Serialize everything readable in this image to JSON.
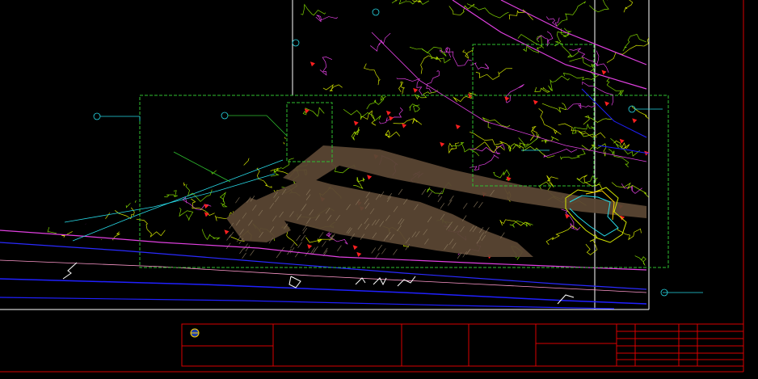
{
  "colors": {
    "background": "#000000",
    "frame": "#d90000",
    "sheet_border": "#ffffff",
    "viewport": "#2fbf2f",
    "contour_yellow": "#d4e600",
    "contour_green": "#7fd400",
    "contour_magenta": "#e040e0",
    "road_fill": "#5a4633",
    "water_blue": "#2020ff",
    "cyan": "#27d9e6",
    "red_marks": "#ff2020",
    "title_text": "#ffd200"
  },
  "icons": [
    "compass-logo-icon",
    "section-marker-icon",
    "north-arrow-icon"
  ]
}
